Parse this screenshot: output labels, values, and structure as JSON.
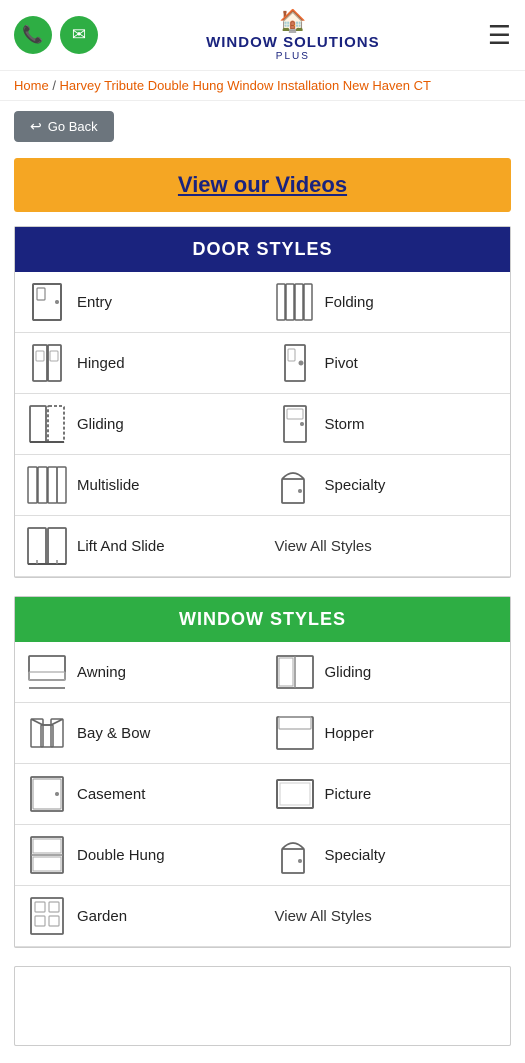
{
  "header": {
    "phone_icon": "📞",
    "email_icon": "✉",
    "logo_icon": "🏠",
    "logo_text": "WINDOW SOLUTIONS",
    "logo_sub": "PLUS",
    "hamburger": "☰"
  },
  "breadcrumb": {
    "home": "Home",
    "separator": "/",
    "current": "Harvey Tribute Double Hung Window Installation New Haven CT"
  },
  "back_button": "Go Back",
  "videos_banner": "View our Videos",
  "door_section": {
    "title": "DOOR STYLES",
    "items": [
      {
        "label": "Entry",
        "col": 0
      },
      {
        "label": "Folding",
        "col": 1
      },
      {
        "label": "Hinged",
        "col": 0
      },
      {
        "label": "Pivot",
        "col": 1
      },
      {
        "label": "Gliding",
        "col": 0
      },
      {
        "label": "Storm",
        "col": 1
      },
      {
        "label": "Multislide",
        "col": 0
      },
      {
        "label": "Specialty",
        "col": 1
      },
      {
        "label": "Lift And Slide",
        "col": 0
      }
    ],
    "view_all": "View All Styles"
  },
  "window_section": {
    "title": "WINDOW STYLES",
    "items": [
      {
        "label": "Awning",
        "col": 0
      },
      {
        "label": "Gliding",
        "col": 1
      },
      {
        "label": "Bay & Bow",
        "col": 0
      },
      {
        "label": "Hopper",
        "col": 1
      },
      {
        "label": "Casement",
        "col": 0
      },
      {
        "label": "Picture",
        "col": 1
      },
      {
        "label": "Double Hung",
        "col": 0
      },
      {
        "label": "Specialty",
        "col": 1
      },
      {
        "label": "Garden",
        "col": 0
      }
    ],
    "view_all": "View All Styles"
  }
}
